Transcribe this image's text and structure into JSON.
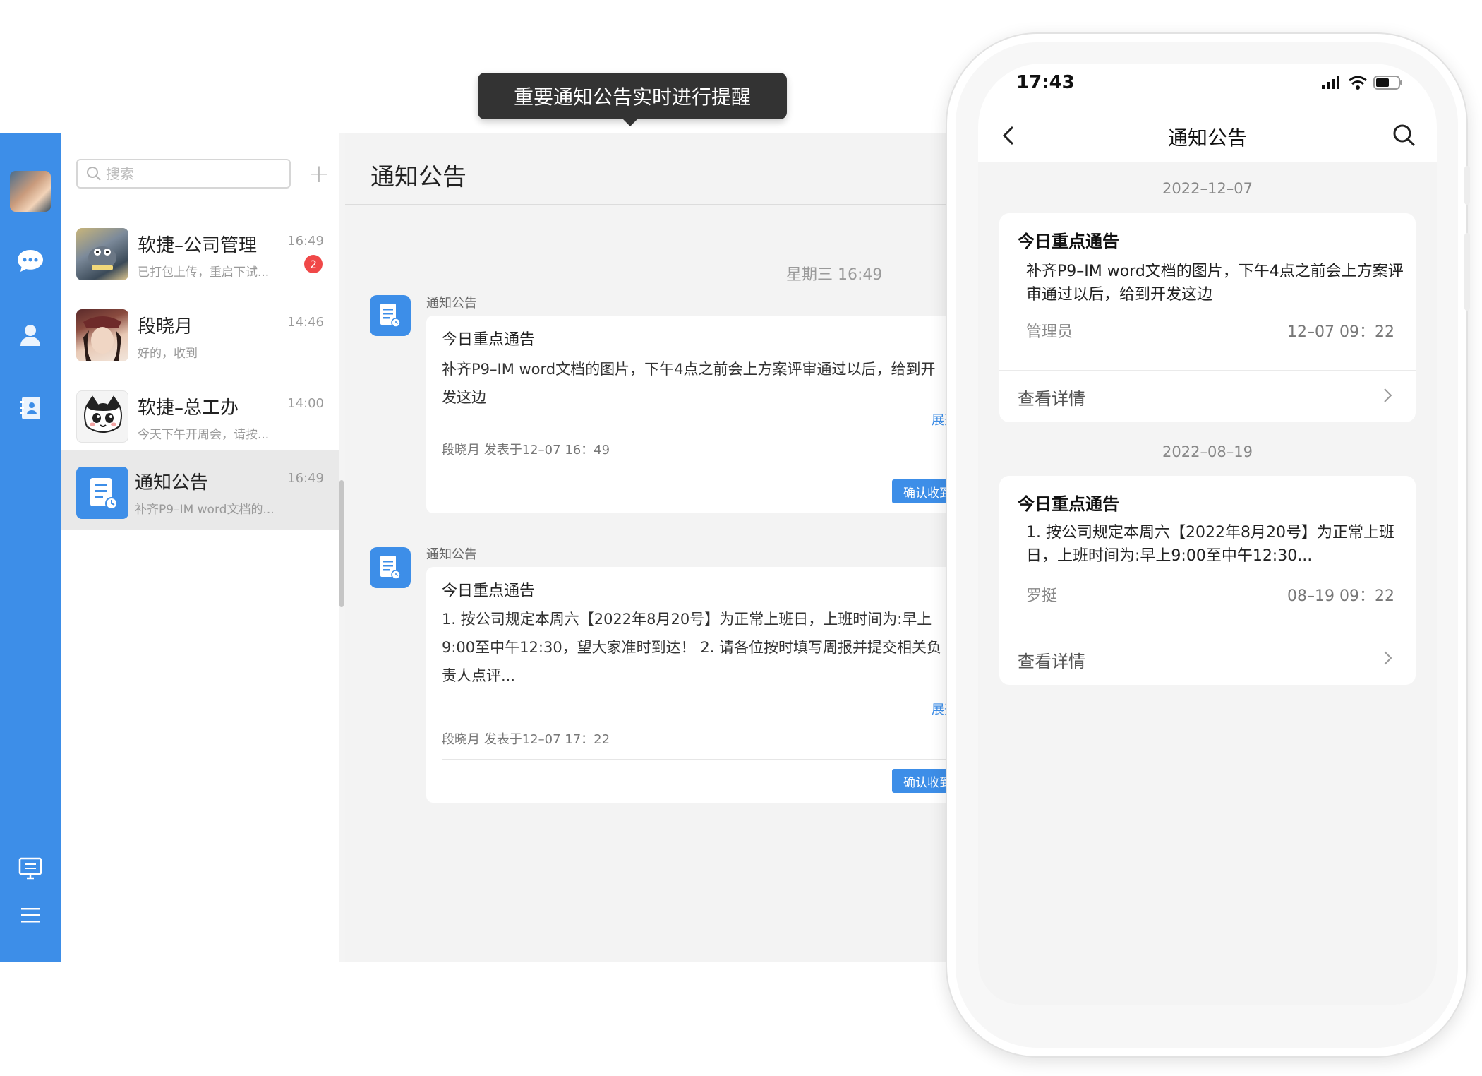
{
  "tooltip": {
    "text": "重要通知公告实时进行提醒"
  },
  "desktop": {
    "search": {
      "placeholder": "搜索",
      "value": ""
    },
    "add_label": "+",
    "conversations": [
      {
        "name": "软捷–公司管理",
        "preview": "已打包上传，重启下试...",
        "time": "16:49",
        "badge": "2"
      },
      {
        "name": "段晓月",
        "preview": "好的，收到",
        "time": "14:46"
      },
      {
        "name": "软捷–总工办",
        "preview": "今天下午开周会，请按...",
        "time": "14:00"
      },
      {
        "name": "通知公告",
        "preview": "补齐P9–IM word文档的...",
        "time": "16:49"
      }
    ],
    "chat": {
      "title": "通知公告",
      "timestamp": "星期三 16:49",
      "messages": [
        {
          "sender": "通知公告",
          "title": "今日重点通告",
          "body": "补齐P9–IM word文档的图片，下午4点之前会上方案评审通过以后，给到开发这边",
          "expand": "展开",
          "meta": "段晓月 发表于12–07 16：49",
          "confirm": "确认收到"
        },
        {
          "sender": "通知公告",
          "title": "今日重点通告",
          "body": "1. 按公司规定本周六【2022年8月20号】为正常上班日，上班时间为:早上9:00至中午12:30，望大家准时到达！ 2. 请各位按时填写周报并提交相关负责人点评...",
          "expand": "展开",
          "meta": "段晓月 发表于12–07 17：22",
          "confirm": "确认收到"
        }
      ]
    }
  },
  "phone": {
    "status_time": "17:43",
    "nav_title": "通知公告",
    "feed": [
      {
        "date": "2022–12–07",
        "title": "今日重点通告",
        "body": "补齐P9–IM word文档的图片，下午4点之前会上方案评审通过以后，给到开发这边",
        "author": "管理员",
        "time": "12–07 09：22",
        "detail": "查看详情"
      },
      {
        "date": "2022–08–19",
        "title": "今日重点通告",
        "body": "1. 按公司规定本周六【2022年8月20号】为正常上班日，上班时间为:早上9:00至中午12:30...",
        "author": "罗挺",
        "time": "08–19 09：22",
        "detail": "查看详情"
      }
    ]
  },
  "colors": {
    "accent": "#3d8ee8",
    "badge": "#f04848",
    "tooltip_bg": "#333333"
  }
}
